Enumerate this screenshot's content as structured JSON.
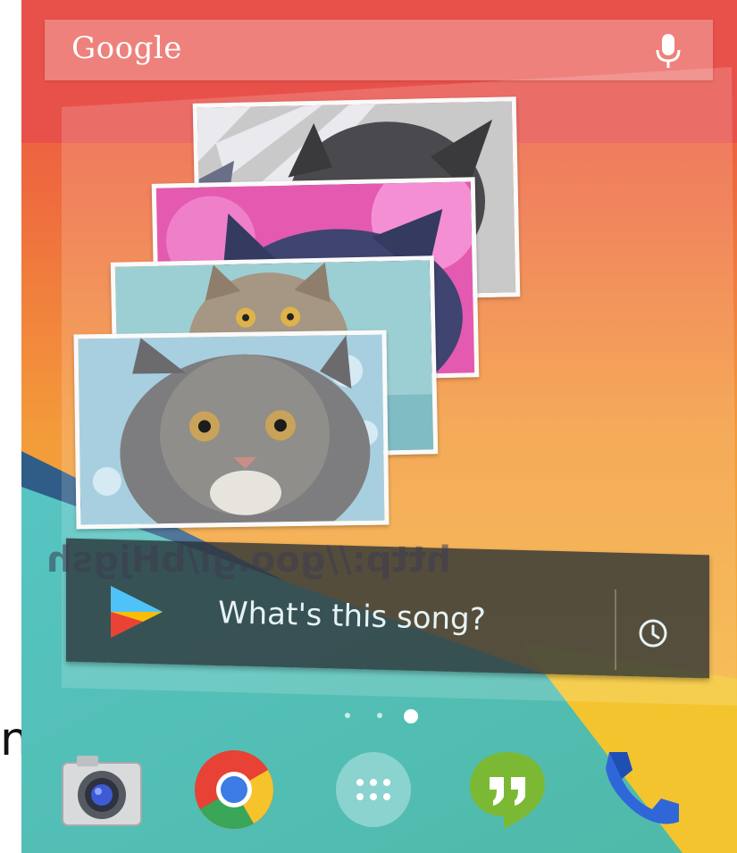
{
  "search": {
    "logo_text": "Google",
    "mic_icon": "microphone-icon"
  },
  "photo_widget": {
    "photos": [
      "kitten-photo-1",
      "kitten-photo-2",
      "kitten-photo-3",
      "kitten-photo-4"
    ]
  },
  "song_widget": {
    "prompt": "What's this song?",
    "play_icon": "play-store-icon",
    "history_icon": "clock-icon"
  },
  "watermark": {
    "text": "http://goo.gl/bHjgsh"
  },
  "stray_letter": "n",
  "page_indicator": {
    "count": 3,
    "active_index": 2
  },
  "dock": {
    "apps": [
      "camera",
      "chrome",
      "app-drawer",
      "hangouts",
      "phone"
    ]
  },
  "colors": {
    "wallpaper_red": "#e8514a",
    "wallpaper_orange": "#f39a3a",
    "wallpaper_yellow": "#f6c13a",
    "wallpaper_teal": "#52bfbd",
    "wallpaper_navy": "#2f5d87",
    "widget_dark": "#283034"
  }
}
